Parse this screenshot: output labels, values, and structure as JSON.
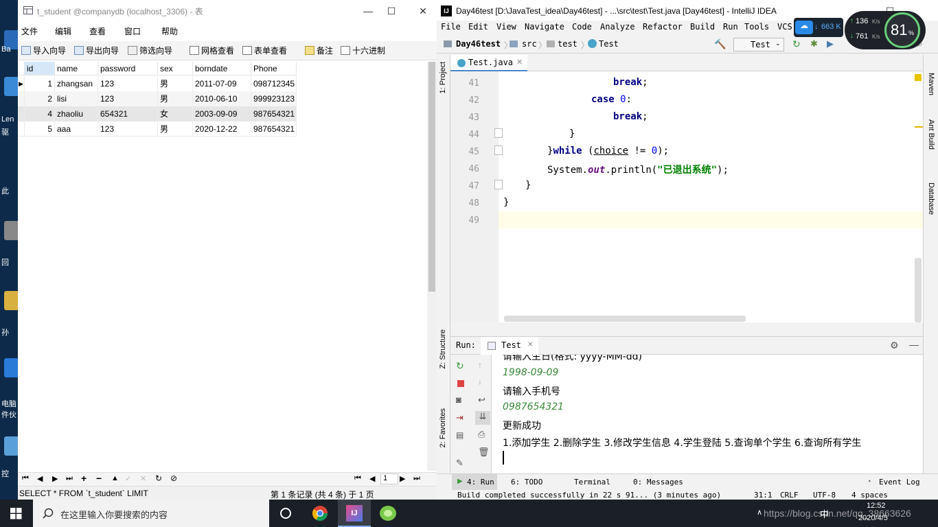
{
  "desktop": {
    "labels": [
      "Ba",
      "Len",
      "驱",
      "此",
      "回",
      "孙",
      "电脑",
      "件伙",
      "控"
    ]
  },
  "navicat": {
    "title": "t_student @companydb (localhost_3306) - 表",
    "menu": [
      "文件",
      "编辑",
      "查看",
      "窗口",
      "帮助"
    ],
    "toolbar": [
      "导入向导",
      "导出向导",
      "筛选向导",
      "网格查看",
      "表单查看",
      "备注",
      "十六进制"
    ],
    "columns": [
      "id",
      "name",
      "password",
      "sex",
      "borndate",
      "Phone"
    ],
    "rows": [
      [
        "1",
        "zhangsan",
        "123",
        "男",
        "2011-07-09",
        "098712345"
      ],
      [
        "2",
        "lisi",
        "123",
        "男",
        "2010-06-10",
        "999923123"
      ],
      [
        "4",
        "zhaoliu",
        "654321",
        "女",
        "2003-09-09",
        "987654321"
      ],
      [
        "5",
        "aaa",
        "123",
        "男",
        "2020-12-22",
        "987654321"
      ]
    ],
    "page_number": "1",
    "sql": "SELECT * FROM `t_student` LIMIT",
    "record_status": "第 1 条记录 (共 4 条) 于 1 页"
  },
  "idea": {
    "title": "Day46test [D:\\JavaTest_idea\\Day46test] - ...\\src\\test\\Test.java [Day46test] - IntelliJ IDEA",
    "menu": [
      "File",
      "Edit",
      "View",
      "Navigate",
      "Code",
      "Analyze",
      "Refactor",
      "Build",
      "Run",
      "Tools",
      "VCS"
    ],
    "breadcrumbs": [
      "Day46test",
      "src",
      "test",
      "Test"
    ],
    "run_config": "Test",
    "file_tab": "Test.java",
    "line_numbers": [
      "41",
      "42",
      "43",
      "44",
      "45",
      "46",
      "47",
      "48",
      "49"
    ],
    "code": {
      "l41": "break",
      "l42a": "case",
      "l42b": "0",
      "l43": "break",
      "l44": "}",
      "l45a": "}",
      "l45b": "while",
      "l45c": "(",
      "l45d": "choice",
      "l45e": "!=",
      "l45f": "0",
      "l45g": ");",
      "l46a": "System.",
      "l46b": "out",
      "l46c": ".println(",
      "l46d": "\"已退出系统\"",
      "l46e": ");",
      "l47": "}",
      "l48": "}"
    },
    "left_panels": [
      "1: Project",
      "Z: Structure",
      "2: Favorites"
    ],
    "right_panels": [
      "Maven",
      "Ant Build",
      "Database"
    ],
    "run_label": "Run:",
    "run_tab": "Test",
    "console": [
      "请输入生日(格式: yyyy-MM-dd)",
      "1998-09-09",
      "请输入手机号",
      "0987654321",
      "更新成功",
      "1.添加学生 2.删除学生 3.修改学生信息 4.学生登陆 5.查询单个学生 6.查询所有学生"
    ],
    "bottom_tabs": [
      "4: Run",
      "6: TODO",
      "Terminal",
      "0: Messages"
    ],
    "event_log": "Event Log",
    "status": [
      "Build completed successfully in 22 s 91... (3 minutes ago)",
      "31:1",
      "CRLF",
      "UTF-8",
      "4 spaces"
    ]
  },
  "net_widget": {
    "speed": "663 K",
    "up": "136",
    "down": "761",
    "unit": "K/s",
    "percent": "81",
    "percent_sign": "%"
  },
  "taskbar": {
    "search_placeholder": "在这里输入你要搜索的内容",
    "time": "12:52",
    "date": "2020/4/5",
    "tray": "中",
    "watermark": "https://blog.csdn.net/qq_38663626"
  }
}
